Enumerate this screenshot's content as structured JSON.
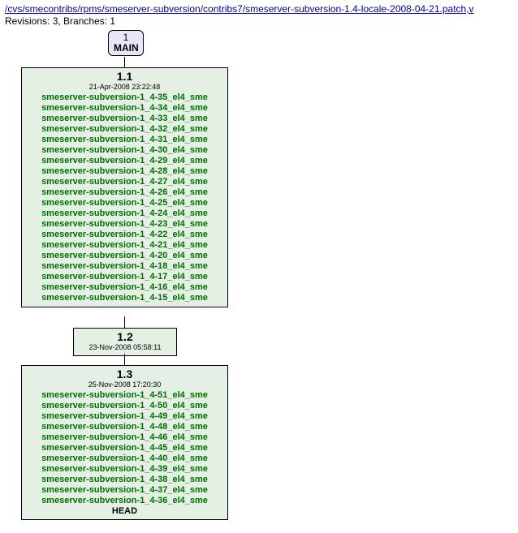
{
  "header": {
    "path": "/cvs/smecontribs/rpms/smeserver-subversion/contribs7/smeserver-subversion-1.4-locale-2008-04-21.patch,v",
    "rev_line": "Revisions: 3, Branches: 1"
  },
  "branch": {
    "num": "1",
    "name": "MAIN"
  },
  "rev11": {
    "ver": "1.1",
    "date": "21-Apr-2008 23:22:48",
    "tags": [
      "smeserver-subversion-1_4-35_el4_sme",
      "smeserver-subversion-1_4-34_el4_sme",
      "smeserver-subversion-1_4-33_el4_sme",
      "smeserver-subversion-1_4-32_el4_sme",
      "smeserver-subversion-1_4-31_el4_sme",
      "smeserver-subversion-1_4-30_el4_sme",
      "smeserver-subversion-1_4-29_el4_sme",
      "smeserver-subversion-1_4-28_el4_sme",
      "smeserver-subversion-1_4-27_el4_sme",
      "smeserver-subversion-1_4-26_el4_sme",
      "smeserver-subversion-1_4-25_el4_sme",
      "smeserver-subversion-1_4-24_el4_sme",
      "smeserver-subversion-1_4-23_el4_sme",
      "smeserver-subversion-1_4-22_el4_sme",
      "smeserver-subversion-1_4-21_el4_sme",
      "smeserver-subversion-1_4-20_el4_sme",
      "smeserver-subversion-1_4-18_el4_sme",
      "smeserver-subversion-1_4-17_el4_sme",
      "smeserver-subversion-1_4-16_el4_sme",
      "smeserver-subversion-1_4-15_el4_sme"
    ]
  },
  "rev12": {
    "ver": "1.2",
    "date": "23-Nov-2008 05:58:11"
  },
  "rev13": {
    "ver": "1.3",
    "date": "25-Nov-2008 17:20:30",
    "tags": [
      "smeserver-subversion-1_4-51_el4_sme",
      "smeserver-subversion-1_4-50_el4_sme",
      "smeserver-subversion-1_4-49_el4_sme",
      "smeserver-subversion-1_4-48_el4_sme",
      "smeserver-subversion-1_4-46_el4_sme",
      "smeserver-subversion-1_4-45_el4_sme",
      "smeserver-subversion-1_4-40_el4_sme",
      "smeserver-subversion-1_4-39_el4_sme",
      "smeserver-subversion-1_4-38_el4_sme",
      "smeserver-subversion-1_4-37_el4_sme",
      "smeserver-subversion-1_4-36_el4_sme"
    ],
    "head": "HEAD"
  }
}
